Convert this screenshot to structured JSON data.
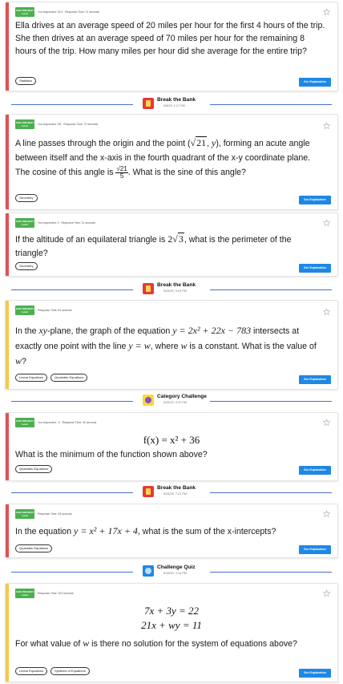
{
  "colors": {
    "accent_red": "#e05252",
    "accent_yellow": "#f2c94c",
    "button_blue": "#1e88e5",
    "divider_blue": "#4a6fd1",
    "badge_green": "#4caf50"
  },
  "common": {
    "see_explanation": "See Explanation",
    "star_icon": "star-outline-icon",
    "badge_text": "SAN FDM BEST Level"
  },
  "cards": [
    {
      "meta": "You responded: 43.3 · Response Time: 21 seconds",
      "question": "Ella drives at an average speed of 20 miles per hour for the first 4 hours of the trip. She then drives at an average speed of 70 miles per hour for the remaining 8 hours of the trip. How many miles per hour did she average for the entire trip?",
      "tags": [
        "Statistics"
      ]
    },
    {
      "meta": "You responded: 2/5 · Response Time: 70 seconds",
      "q_part1": "A line passes through the origin and the point (",
      "q_sqrt": "21",
      "q_part2": ", ",
      "q_y": "y",
      "q_part3": "), forming an acute angle between itself and the x-axis in the fourth quadrant of the x-y coordinate plane. The cosine of this angle is ",
      "q_frac_num": "21",
      "q_frac_den": "5",
      "q_part4": ". What is the sine of this angle?",
      "tags": [
        "Geometry"
      ]
    },
    {
      "meta": "You responded: 3 · Response Time: 11 seconds",
      "q_part1": "If the altitude of an equilateral triangle is ",
      "q_coef": "2",
      "q_sqrt": "3",
      "q_part2": ", what is the perimeter of the triangle?",
      "tags": [
        "Geometry"
      ]
    },
    {
      "meta": "Response Time: 81 seconds",
      "q_part1": "In the ",
      "q_plane": "xy",
      "q_part2": "-plane, the graph of the equation ",
      "q_eq": "y = 2x² + 22x − 783",
      "q_part3": " intersects at exactly one point with the line ",
      "q_line": "y = w",
      "q_part4": ", where ",
      "q_w": "w",
      "q_part5": " is a constant. What is the value of ",
      "q_w2": "w",
      "q_part6": "?",
      "tags": [
        "Linear Equations",
        "Quadratic Equations"
      ]
    },
    {
      "meta": "You responded: -4 · Response Time: 30 seconds",
      "equation": "f(x) = x² + 36",
      "question": "What is the minimum of the function shown above?",
      "tags": [
        "Quadratic Equations"
      ]
    },
    {
      "meta": "Response Time: 63 seconds",
      "q_part1": "In the equation ",
      "q_eq": "y = x² + 17x + 4",
      "q_part2": ", what is the sum of the x-intercepts?",
      "tags": [
        "Quadratic Equations"
      ]
    },
    {
      "meta": "Response Time: 103 seconds",
      "eq1": "7x + 3y = 22",
      "eq2": "21x + wy = 11",
      "q_part1": "For what value of ",
      "q_w": "w",
      "q_part2": " is there no solution for the system of equations above?",
      "tags": [
        "Linear Equations",
        "Systems of Equations"
      ]
    }
  ],
  "dividers": [
    {
      "title": "Break the Bank",
      "date": "9/8/25, 1:17 PM",
      "icon": "piggy-bank-icon"
    },
    {
      "title": "Break the Bank",
      "date": "8/26/25, 6:03 PM",
      "icon": "piggy-bank-icon"
    },
    {
      "title": "Category Challenge",
      "date": "8/26/25, 5:33 PM",
      "icon": "category-icon"
    },
    {
      "title": "Break the Bank",
      "date": "8/25/25, 7:21 PM",
      "icon": "piggy-bank-icon"
    },
    {
      "title": "Challenge Quiz",
      "date": "8/18/25, 3:16 PM",
      "icon": "quiz-icon"
    }
  ]
}
